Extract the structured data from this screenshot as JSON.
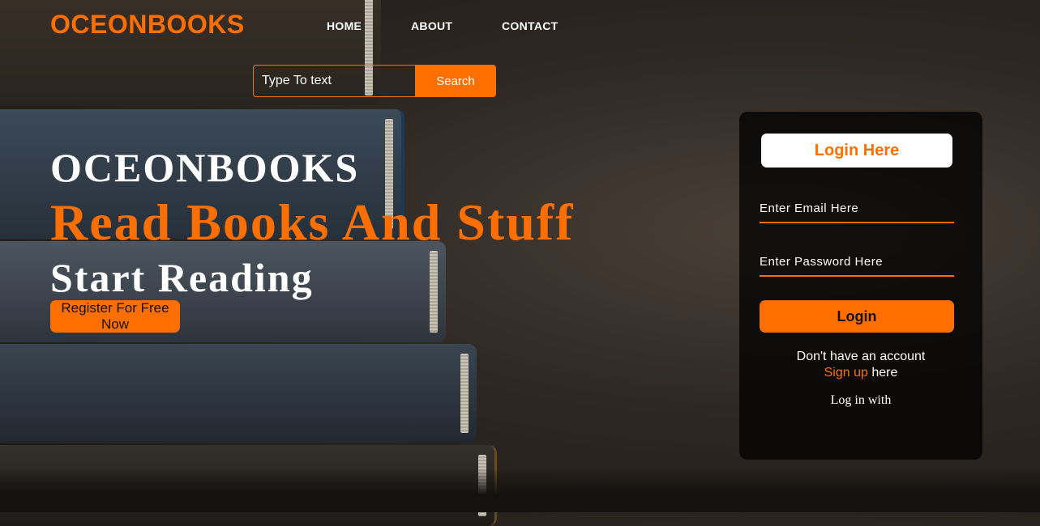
{
  "header": {
    "logo": "OCEONBOOKS",
    "nav": [
      "HOME",
      "ABOUT",
      "CONTACT"
    ]
  },
  "search": {
    "placeholder": "Type To text",
    "button_label": "Search"
  },
  "hero": {
    "title": "OCEONBOOKS",
    "subtitle": "Read Books And Stuff",
    "cta_text": "Start Reading",
    "register_label": "Register For Free Now"
  },
  "login": {
    "heading": "Login Here",
    "email_placeholder": "Enter Email Here",
    "password_placeholder": "Enter Password Here",
    "button_label": "Login",
    "no_account_text": "Don't have an account",
    "signup_link": "Sign up",
    "signup_suffix": " here",
    "login_with": "Log in with"
  },
  "colors": {
    "accent": "#ff6f00",
    "card_bg": "#000000",
    "text": "#ffffff"
  }
}
